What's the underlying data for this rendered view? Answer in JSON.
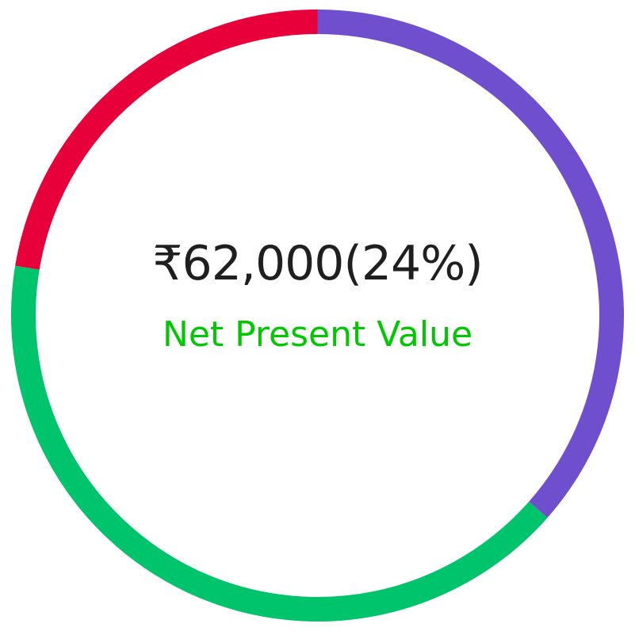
{
  "chart_data": {
    "type": "pie",
    "variant": "donut",
    "start": "top",
    "direction": "clockwise",
    "slices": [
      {
        "share": 0.365,
        "color": "#6f4fcd"
      },
      {
        "share": 0.411,
        "color": "#00c46b"
      },
      {
        "share": 0.224,
        "color": "#e8003a"
      }
    ],
    "center_value": "₹62,000(24%)",
    "center_label": "Net Present Value",
    "center_label_color": "#00c800"
  }
}
